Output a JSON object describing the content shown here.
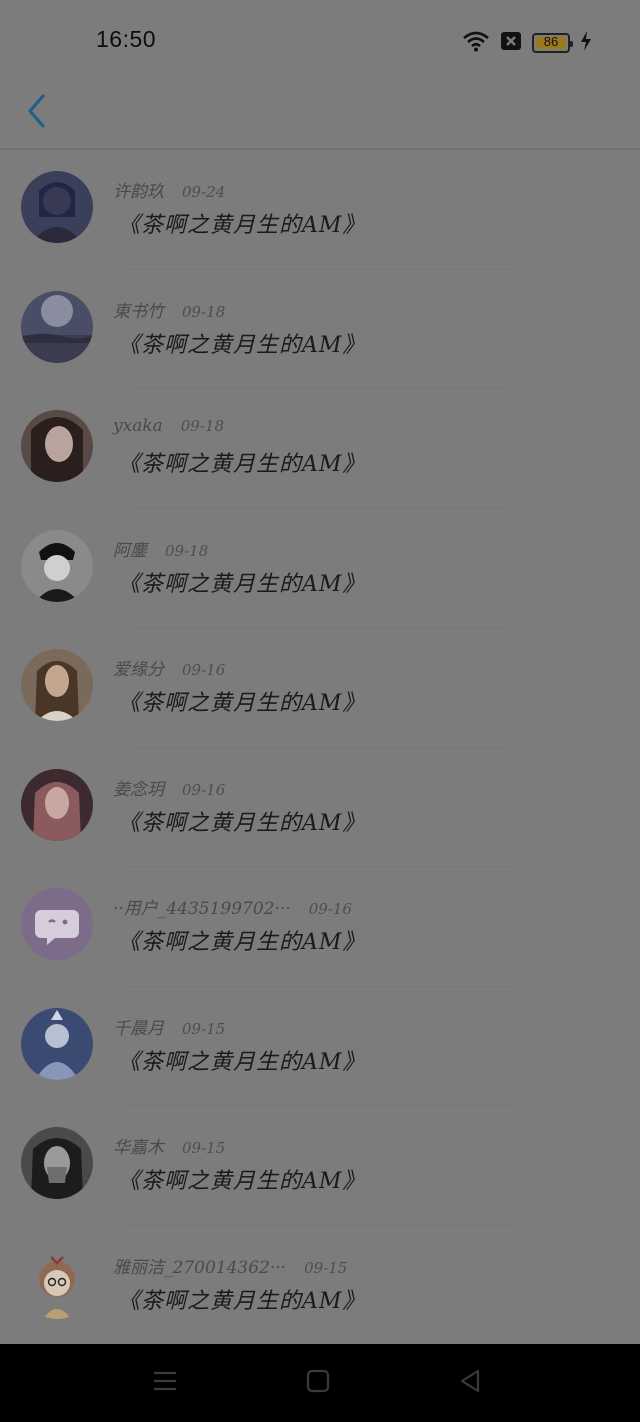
{
  "status_bar": {
    "time": "16:50",
    "battery_level": "86",
    "icons": [
      "wifi-icon",
      "signal-off-icon",
      "battery-icon",
      "charging-icon"
    ]
  },
  "header": {
    "back_icon": "chevron-left-icon"
  },
  "entries": [
    {
      "name": "许韵玖",
      "date": "09-24",
      "title": "《茶啊之黄月生的AM》"
    },
    {
      "name": "東书竹",
      "date": "09-18",
      "title": "《茶啊之黄月生的AM》"
    },
    {
      "name": "yxaka",
      "date": "09-18",
      "title": "《茶啊之黄月生的AM》"
    },
    {
      "name": "阿鏖",
      "date": "09-18",
      "title": "《茶啊之黄月生的AM》"
    },
    {
      "name": "爱缘分",
      "date": "09-16",
      "title": "《茶啊之黄月生的AM》"
    },
    {
      "name": "姜念玥",
      "date": "09-16",
      "title": "《茶啊之黄月生的AM》"
    },
    {
      "name": "··用户_4435199702···",
      "date": "09-16",
      "title": "《茶啊之黄月生的AM》"
    },
    {
      "name": "千晨月",
      "date": "09-15",
      "title": "《茶啊之黄月生的AM》"
    },
    {
      "name": "华嘉木",
      "date": "09-15",
      "title": "《茶啊之黄月生的AM》"
    },
    {
      "name": "雅丽洁_270014362···",
      "date": "09-15",
      "title": "《茶啊之黄月生的AM》"
    }
  ],
  "nav_bar": {
    "icons": [
      "menu-icon",
      "home-icon",
      "back-triangle-icon"
    ]
  },
  "colors": {
    "overlay": "#7c7c7c",
    "accent": "#1f5f8a",
    "nav_bar": "#000000"
  }
}
